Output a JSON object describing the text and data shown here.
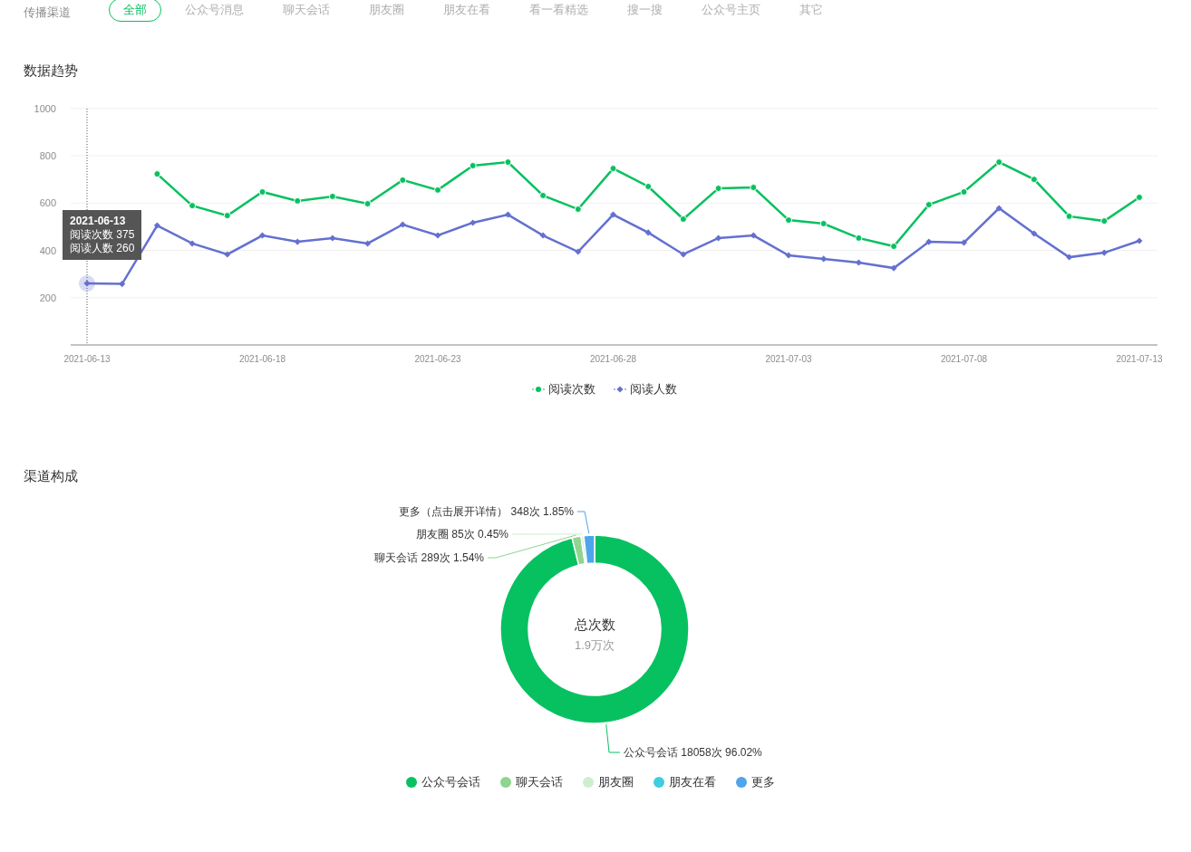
{
  "channel_filter": {
    "label": "传播渠道",
    "tabs": [
      {
        "label": "全部",
        "selected": true
      },
      {
        "label": "公众号消息",
        "selected": false
      },
      {
        "label": "聊天会话",
        "selected": false
      },
      {
        "label": "朋友圈",
        "selected": false
      },
      {
        "label": "朋友在看",
        "selected": false
      },
      {
        "label": "看一看精选",
        "selected": false
      },
      {
        "label": "搜一搜",
        "selected": false
      },
      {
        "label": "公众号主页",
        "selected": false
      },
      {
        "label": "其它",
        "selected": false
      }
    ]
  },
  "trend": {
    "title": "数据趋势",
    "chart_data": {
      "type": "line",
      "categories": [
        "2021-06-13",
        null,
        null,
        null,
        null,
        "2021-06-18",
        null,
        null,
        null,
        null,
        "2021-06-23",
        null,
        null,
        null,
        null,
        "2021-06-28",
        null,
        null,
        null,
        null,
        "2021-07-03",
        null,
        null,
        null,
        null,
        "2021-07-08",
        null,
        null,
        null,
        null,
        "2021-07-13"
      ],
      "ylim": [
        0,
        1000
      ],
      "yticks": [
        200,
        400,
        600,
        800,
        1000
      ],
      "grid": true,
      "series": [
        {
          "name": "阅读次数",
          "color": "#07c160",
          "marker": "circle",
          "values": [
            null,
            null,
            723,
            589,
            547,
            647,
            609,
            628,
            597,
            697,
            655,
            758,
            773,
            632,
            574,
            746,
            670,
            532,
            662,
            666,
            528,
            513,
            452,
            417,
            593,
            647,
            773,
            700,
            544,
            524,
            624
          ]
        },
        {
          "name": "阅读人数",
          "color": "#6470d0",
          "marker": "diamond",
          "values": [
            260,
            258,
            505,
            429,
            383,
            463,
            436,
            452,
            429,
            509,
            463,
            517,
            551,
            463,
            394,
            551,
            475,
            383,
            452,
            463,
            379,
            364,
            348,
            325,
            436,
            433,
            578,
            471,
            371,
            390,
            440
          ]
        }
      ]
    },
    "tooltip": {
      "title": "2021-06-13",
      "lines": [
        "阅读次数 375",
        "阅读人数 260"
      ]
    }
  },
  "channels": {
    "title": "渠道构成",
    "chart_data": {
      "type": "donut",
      "categories": [
        "公众号会话",
        "聊天会话",
        "朋友圈",
        "朋友在看",
        "更多"
      ],
      "values": [
        96.02,
        1.54,
        0.45,
        null,
        1.85
      ]
    },
    "slice_labels": [
      "更多（点击展开详情） 348次 1.85%",
      "朋友圈 85次 0.45%",
      "聊天会话 289次 1.54%",
      "公众号会话 18058次 96.02%"
    ],
    "center_title": "总次数",
    "center_value": "1.9万次",
    "legend": [
      {
        "color": "#07c160"
      },
      {
        "color": "#8fd48f"
      },
      {
        "color": "#cfeecf"
      },
      {
        "color": "#3fcee0"
      },
      {
        "color": "#4ea5ec"
      }
    ]
  }
}
